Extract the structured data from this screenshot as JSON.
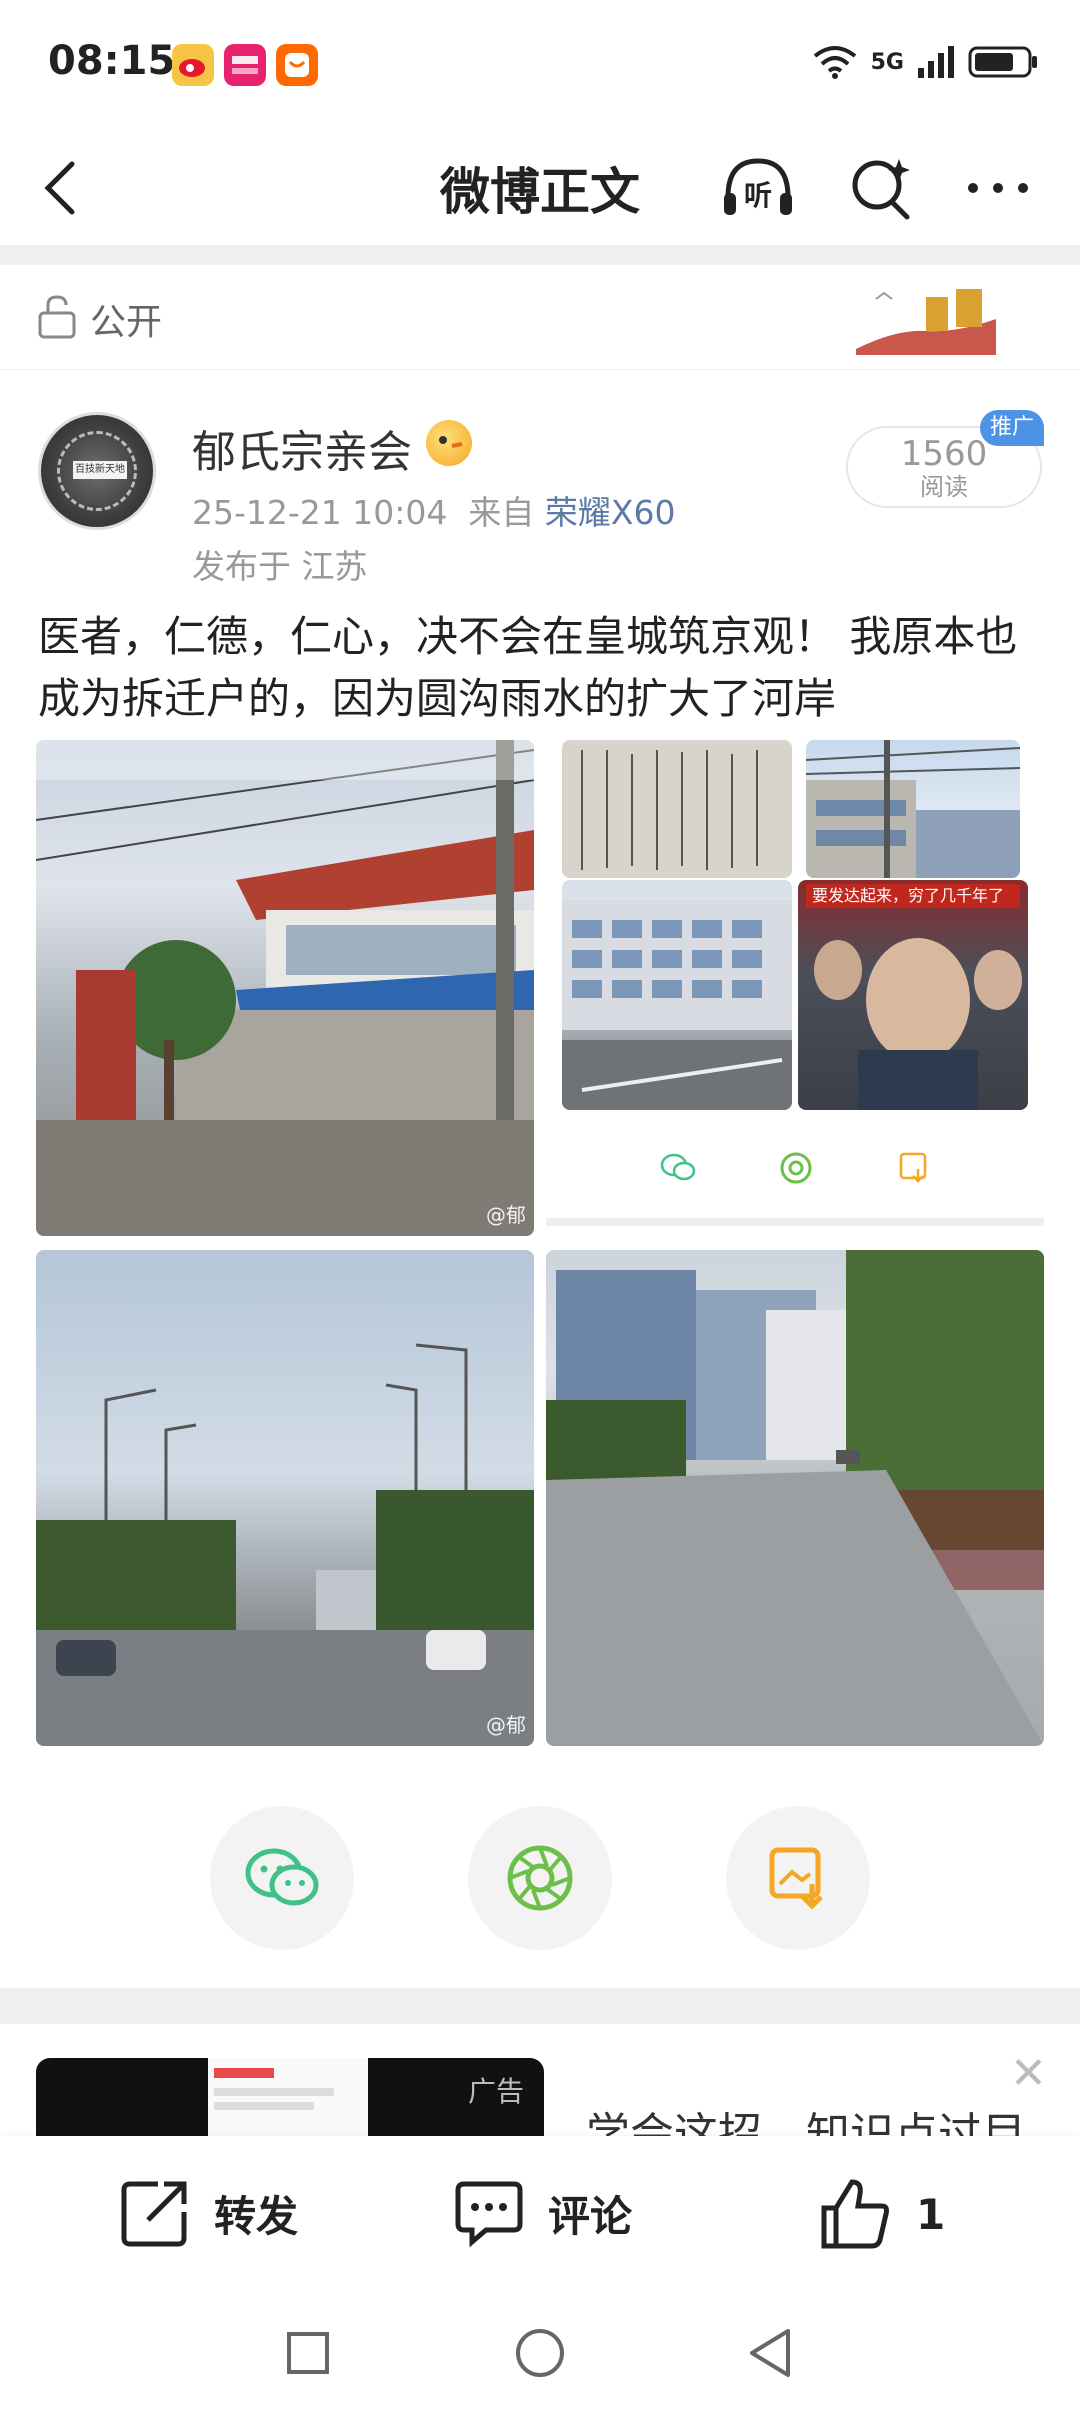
{
  "status_bar": {
    "time": "08:15",
    "network": "5G"
  },
  "nav": {
    "title": "微博正文",
    "listen_label": "听"
  },
  "visibility": {
    "label": "公开"
  },
  "post": {
    "author": "郁氏宗亲会",
    "avatar_text": "百技新天地",
    "datetime": "25-12-21 10:04",
    "source_prefix": "来自",
    "device": "荣耀X60",
    "location": "发布于 江苏",
    "read_count": "1560",
    "read_label": "阅读",
    "promo_label": "推广",
    "text": "医者，仁德，仁心，决不会在皇城筑京观！ 我原本也成为拆迁户的，因为圆沟雨水的扩大了河岸",
    "images": [
      {
        "name": "blue-wall-street-photo",
        "watermark": "@郁"
      },
      {
        "name": "handwritten-document-photo"
      },
      {
        "name": "factory-building-photo"
      },
      {
        "name": "office-building-street-photo"
      },
      {
        "name": "news-screenshot-photo",
        "caption": "要发达起来，穷了几千年了"
      },
      {
        "name": "tree-lined-road-photo",
        "watermark": "@郁"
      },
      {
        "name": "empty-road-factories-photo"
      }
    ]
  },
  "share": {
    "wechat": "wechat-icon",
    "moments": "moments-icon",
    "save": "save-image-icon"
  },
  "ad": {
    "label": "广告",
    "text": "学会这招，知识点过目"
  },
  "actions": {
    "repost": "转发",
    "comment": "评论",
    "like_count": "1"
  },
  "colors": {
    "accent_blue": "#5c7aa6",
    "wechat_green": "#3fc188",
    "moments_green": "#6cc04a",
    "save_orange": "#f5a623",
    "promo_blue": "#4c93e6"
  }
}
